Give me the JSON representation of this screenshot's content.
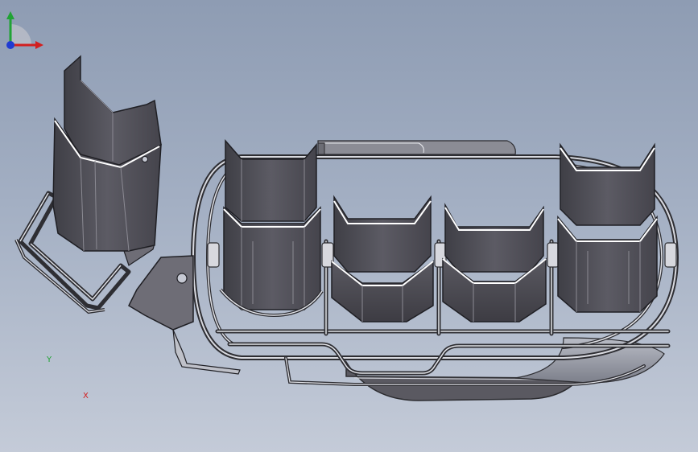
{
  "viewport": {
    "background_top": "#8e9cb3",
    "background_bottom": "#c4cbd8"
  },
  "colors": {
    "panel_dark": "#4a4a52",
    "panel_mid": "#5c5b64",
    "panel_light": "#6b6a73",
    "wire": "#3e3e44",
    "wire_light": "#e6e6ea",
    "highlight": "#ffffff",
    "axis_x": "#d21f1f",
    "axis_y": "#21a335",
    "axis_z": "#1f3bd2"
  },
  "triad": {
    "x_label": "X",
    "y_label": "Y",
    "icon": "coordinate-triad-icon"
  }
}
